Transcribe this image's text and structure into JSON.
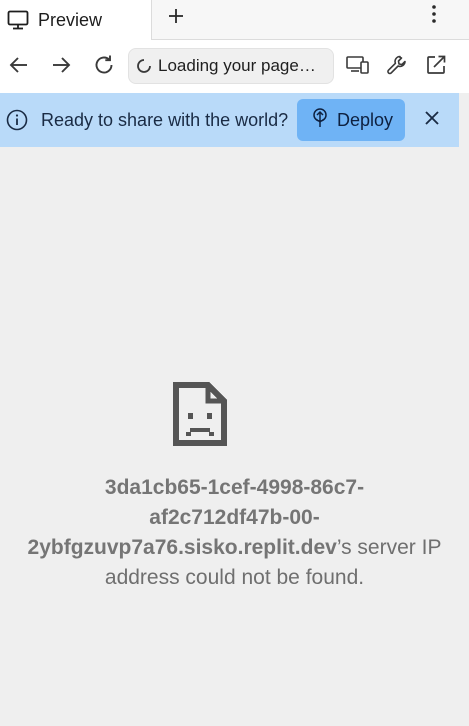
{
  "tab": {
    "label": "Preview",
    "icon": "monitor-icon"
  },
  "tabbar": {
    "new_tab_icon": "plus-icon",
    "menu_icon": "more-vertical-icon"
  },
  "nav": {
    "back_icon": "arrow-left-icon",
    "forward_icon": "arrow-right-icon",
    "reload_icon": "refresh-icon",
    "url_text": "Loading your page…",
    "devices_icon": "devices-icon",
    "devtools_icon": "wrench-icon",
    "open_external_icon": "external-link-icon"
  },
  "banner": {
    "text": "Ready to share with the world?",
    "deploy_label": "Deploy",
    "info_icon": "info-icon",
    "deploy_icon": "deploy-icon",
    "close_icon": "close-icon"
  },
  "error": {
    "host_line1": "3da1cb65-1cef-4998-86c7-",
    "host_line2": "af2c712df47b-00-",
    "host_line3": "2ybfgzuvp7a76.sisko.replit.dev",
    "message_suffix": "’s server IP",
    "message_line4": "address could not be found.",
    "icon": "sad-document-icon"
  },
  "colors": {
    "banner_bg": "#b9daf9",
    "deploy_bg": "#6fb3f5",
    "page_bg": "#efefef",
    "error_text": "#6f6f6f"
  }
}
